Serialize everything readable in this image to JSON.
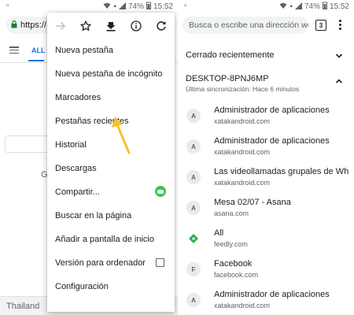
{
  "status_bar": {
    "battery": "74%",
    "time": "15:52"
  },
  "left": {
    "omnibox_text": "https://",
    "tab_all": "ALL",
    "footer_text": "Thailand",
    "bg_letter": "G"
  },
  "menu": {
    "icons": [
      "forward-icon",
      "star-icon",
      "download-icon",
      "info-icon",
      "refresh-icon"
    ],
    "items": [
      "Nueva pestaña",
      "Nueva pestaña de incógnito",
      "Marcadores",
      "Pestañas recientes",
      "Historial",
      "Descargas",
      "Compartir...",
      "Buscar en la página",
      "Añadir a pantalla de inicio",
      "Versión para ordenador",
      "Configuración"
    ]
  },
  "right": {
    "omnibox_placeholder": "Busca o escribe una dirección we",
    "tab_count": "3",
    "recently_closed": "Cerrado recientemente",
    "device_name": "DESKTOP-8PNJ6MP",
    "last_sync": "Última sincronización: Hace 6 minutos",
    "entries": [
      {
        "favicon": "A",
        "title": "Administrador de aplicaciones",
        "url": "xatakandroid.com"
      },
      {
        "favicon": "A",
        "title": "Administrador de aplicaciones",
        "url": "xatakandroid.com"
      },
      {
        "favicon": "A",
        "title": "Las videollamadas grupales de Whats...",
        "url": "xatakandroid.com"
      },
      {
        "favicon": "A",
        "title": "Mesa 02/07 - Asana",
        "url": "asana.com"
      },
      {
        "favicon": "feedly",
        "title": "All",
        "url": "feedly.com"
      },
      {
        "favicon": "F",
        "title": "Facebook",
        "url": "facebook.com"
      },
      {
        "favicon": "A",
        "title": "Administrador de aplicaciones",
        "url": "xatakandroid.com"
      }
    ]
  },
  "colors": {
    "accent": "#1a73e8",
    "arrow": "#f6c233",
    "share_green": "#3cc64f",
    "feedly_green": "#2bb24c"
  }
}
